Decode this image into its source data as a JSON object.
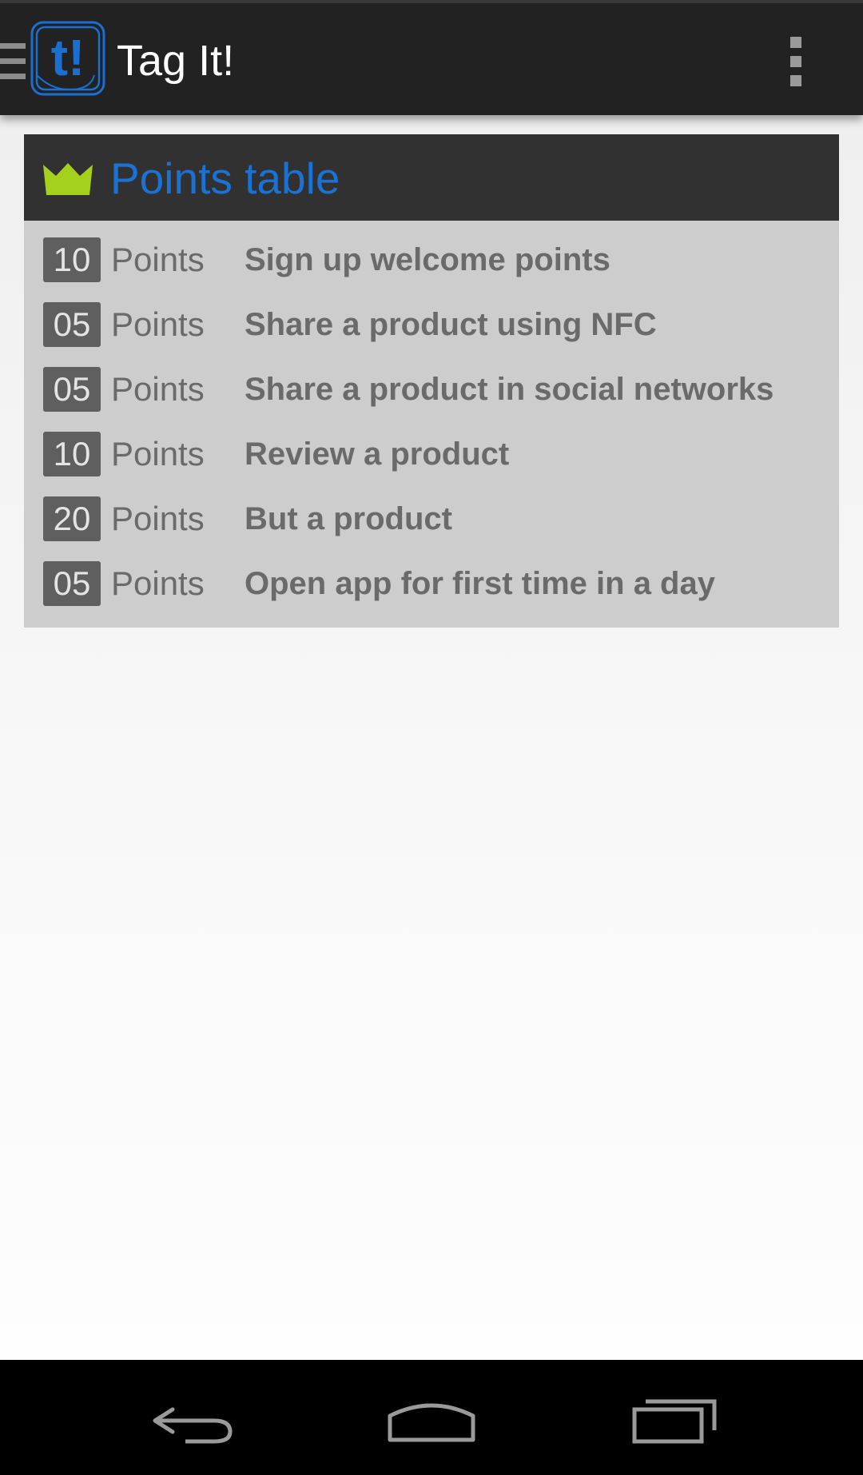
{
  "action_bar": {
    "title": "Tag It!",
    "logo_text": "t!",
    "icons": {
      "drawer": "drawer-menu-icon",
      "overflow": "overflow-menu-icon"
    }
  },
  "points_table": {
    "title": "Points table",
    "header_icon": "crown-icon",
    "unit_label": "Points",
    "rows": [
      {
        "points": "10",
        "action": "Sign up welcome points"
      },
      {
        "points": "05",
        "action": "Share a product using NFC"
      },
      {
        "points": "05",
        "action": "Share a product in social networks"
      },
      {
        "points": "10",
        "action": "Review a product"
      },
      {
        "points": "20",
        "action": "But a product"
      },
      {
        "points": "05",
        "action": "Open app for first time in a day"
      }
    ]
  },
  "nav_bar": {
    "icons": [
      "back-icon",
      "home-icon",
      "recent-apps-icon"
    ]
  },
  "colors": {
    "action_bar_bg": "#222222",
    "accent_blue": "#1a73d4",
    "crown_green": "#a3d11c",
    "card_header_bg": "#313131",
    "card_body_bg": "#cdcdcd",
    "badge_bg": "#5f5f5f",
    "row_text": "#6a6a6a"
  }
}
